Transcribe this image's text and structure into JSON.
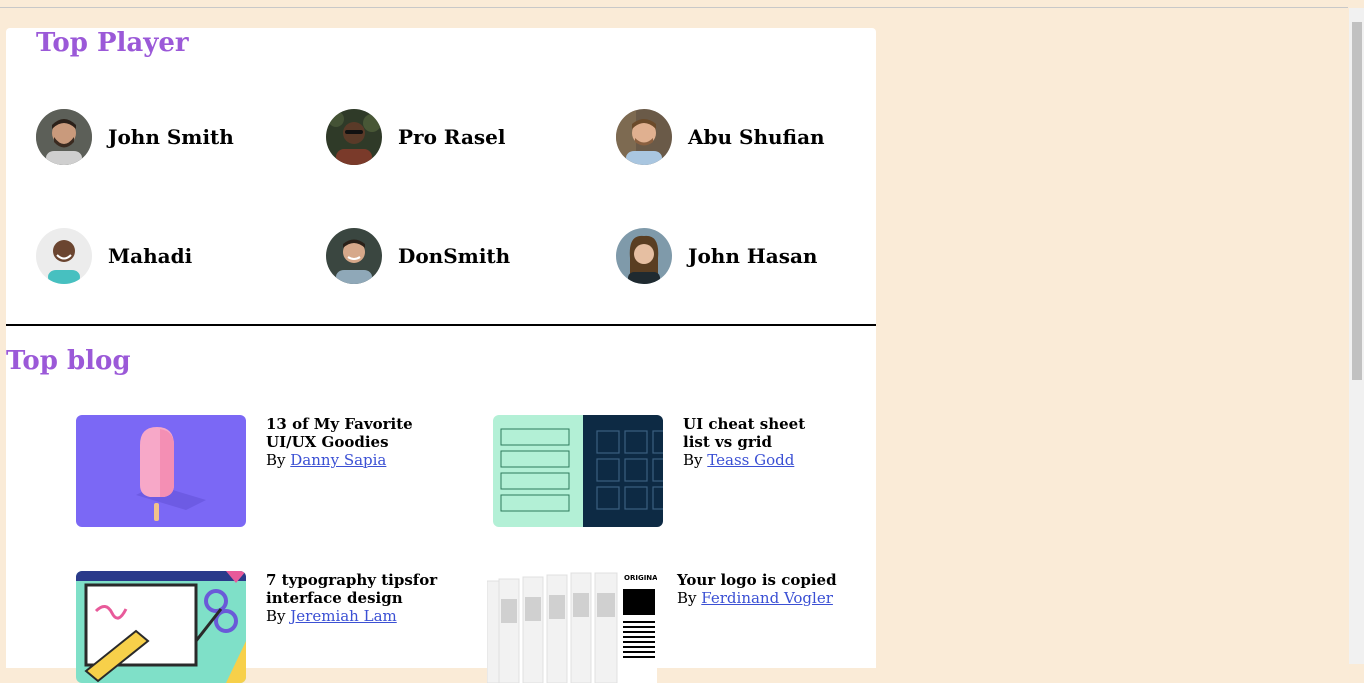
{
  "players_section": {
    "title": "Top Player",
    "players": [
      {
        "name": "John Smith"
      },
      {
        "name": "Pro Rasel"
      },
      {
        "name": "Abu Shufian"
      },
      {
        "name": "Mahadi"
      },
      {
        "name": "DonSmith"
      },
      {
        "name": "John Hasan"
      }
    ]
  },
  "blog_section": {
    "title": "Top blog",
    "posts": [
      {
        "title": "13 of My Favorite UI/UX Goodies",
        "by": "By",
        "author": "Danny Sapia",
        "image": "popsicle-illustration"
      },
      {
        "title": "UI cheat sheet list vs grid",
        "by": "By",
        "author": "Teass Godd",
        "image": "list-grid-illustration"
      },
      {
        "title": "7 typography tipsfor interface design",
        "by": "By",
        "author": "Jeremiah Lam",
        "image": "typography-tools-illustration"
      },
      {
        "title": "Your logo is copied",
        "by": "By",
        "author": "Ferdinand Vogler",
        "image": "logo-copies-illustration",
        "image_text": "ORIGINA"
      }
    ]
  },
  "colors": {
    "page_bg": "#faebd7",
    "accent": "#9b59d8",
    "link": "#3b50d4"
  }
}
